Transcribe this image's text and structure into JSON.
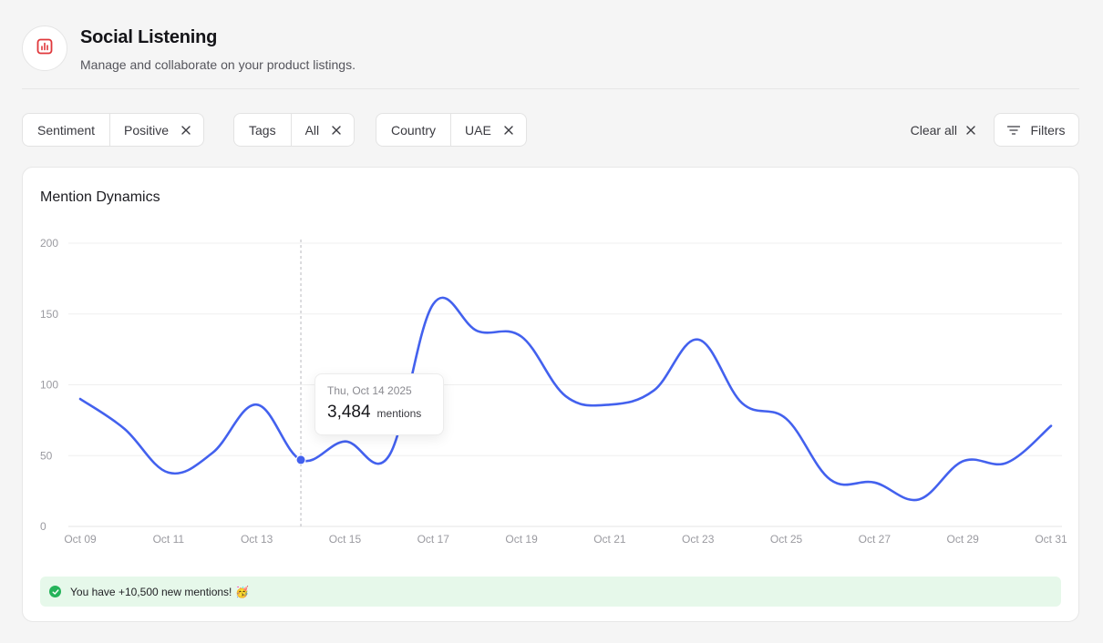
{
  "header": {
    "title": "Social Listening",
    "subtitle": "Manage and collaborate on your product listings.",
    "icon": "bar-chart-icon",
    "accent_color": "#e0373b"
  },
  "filters": {
    "chips": [
      {
        "key": "Sentiment",
        "value": "Positive"
      },
      {
        "key": "Tags",
        "value": "All"
      },
      {
        "key": "Country",
        "value": "UAE"
      }
    ],
    "clear_all_label": "Clear all",
    "filters_label": "Filters"
  },
  "card": {
    "title": "Mention Dynamics",
    "tooltip": {
      "date": "Thu, Oct 14 2025",
      "value": "3,484",
      "unit": "mentions"
    },
    "banner": {
      "prefix": "You have ",
      "highlight": "+10,500",
      "suffix": " new mentions!",
      "emoji": "🥳"
    }
  },
  "chart_data": {
    "type": "line",
    "title": "Mention Dynamics",
    "x": [
      "Oct 09",
      "Oct 10",
      "Oct 11",
      "Oct 12",
      "Oct 13",
      "Oct 14",
      "Oct 15",
      "Oct 16",
      "Oct 17",
      "Oct 18",
      "Oct 19",
      "Oct 20",
      "Oct 21",
      "Oct 22",
      "Oct 23",
      "Oct 24",
      "Oct 25",
      "Oct 26",
      "Oct 27",
      "Oct 28",
      "Oct 29",
      "Oct 30",
      "Oct 31"
    ],
    "xticks": [
      "Oct 09",
      "Oct 11",
      "Oct 13",
      "Oct 15",
      "Oct 17",
      "Oct 19",
      "Oct 21",
      "Oct 23",
      "Oct 25",
      "Oct 27",
      "Oct 29",
      "Oct 31"
    ],
    "series": [
      {
        "values": [
          90,
          69,
          38,
          52,
          86,
          47,
          60,
          50,
          157,
          138,
          134,
          92,
          86,
          96,
          132,
          87,
          76,
          33,
          31,
          19,
          46,
          45,
          71
        ]
      }
    ],
    "ylim": [
      0,
      200
    ],
    "yticks": [
      0,
      50,
      100,
      150,
      200
    ],
    "grid": true,
    "line_color": "#4361ee",
    "highlight_x": "Oct 14"
  }
}
